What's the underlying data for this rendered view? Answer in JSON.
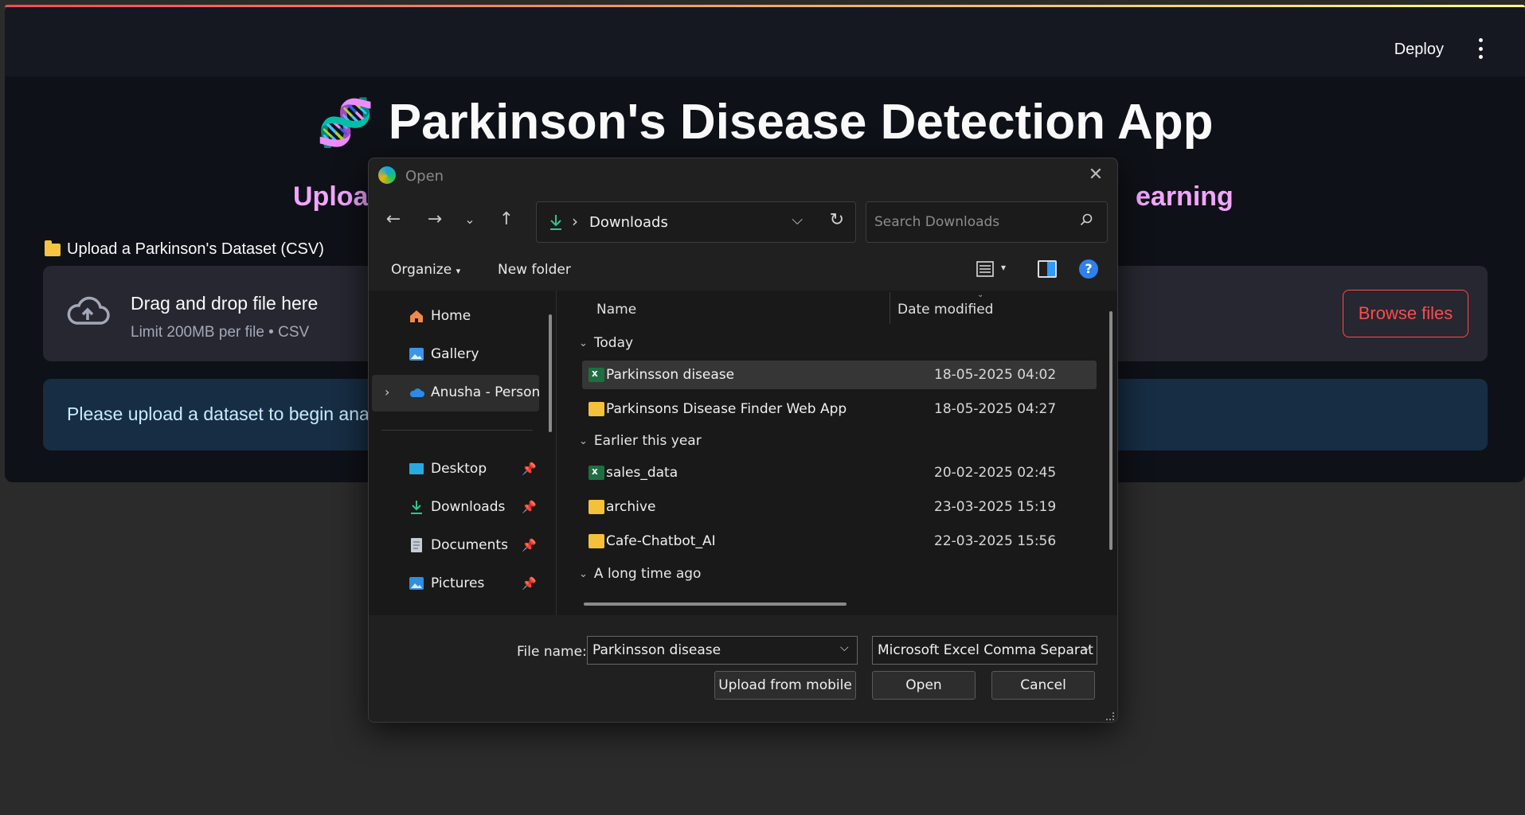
{
  "app": {
    "deploy_label": "Deploy",
    "title": "Parkinson's Disease Detection App",
    "subtitle_left": "Uploa",
    "subtitle_right": "earning",
    "upload_label": "Upload a Parkinson's Dataset (CSV)",
    "dropzone_title": "Drag and drop file here",
    "dropzone_sub": "Limit 200MB per file • CSV",
    "browse_label": "Browse files",
    "info_text": "Please upload a dataset to begin analy",
    "accent_color": "#ff4b4b",
    "subtitle_color": "#f3a6ff"
  },
  "dialog": {
    "title": "Open",
    "address_path": "Downloads",
    "search_placeholder": "Search Downloads",
    "toolbar": {
      "organize": "Organize",
      "new_folder": "New folder"
    },
    "nav_items": [
      {
        "label": "Home",
        "icon": "home-icon"
      },
      {
        "label": "Gallery",
        "icon": "gallery-icon"
      },
      {
        "label": "Anusha - Person",
        "icon": "onedrive-icon"
      },
      {
        "label": "Desktop",
        "icon": "desktop-icon"
      },
      {
        "label": "Downloads",
        "icon": "download-icon"
      },
      {
        "label": "Documents",
        "icon": "documents-icon"
      },
      {
        "label": "Pictures",
        "icon": "pictures-icon"
      }
    ],
    "columns": {
      "name": "Name",
      "date_modified": "Date modified"
    },
    "groups": [
      {
        "label": "Today",
        "files": [
          {
            "name": "Parkinsson disease",
            "date": "18-05-2025 04:02",
            "type": "excel"
          },
          {
            "name": "Parkinsons Disease Finder Web App",
            "date": "18-05-2025 04:27",
            "type": "folder"
          }
        ]
      },
      {
        "label": "Earlier this year",
        "files": [
          {
            "name": "sales_data",
            "date": "20-02-2025 02:45",
            "type": "excel"
          },
          {
            "name": "archive",
            "date": "23-03-2025 15:19",
            "type": "folder"
          },
          {
            "name": "Cafe-Chatbot_AI",
            "date": "22-03-2025 15:56",
            "type": "folder"
          }
        ]
      },
      {
        "label": "A long time ago",
        "files": []
      }
    ],
    "footer": {
      "file_name_label": "File name:",
      "file_name_value": "Parkinsson disease",
      "file_type_value": "Microsoft Excel Comma Separat",
      "upload_mobile": "Upload from mobile",
      "open": "Open",
      "cancel": "Cancel"
    }
  }
}
